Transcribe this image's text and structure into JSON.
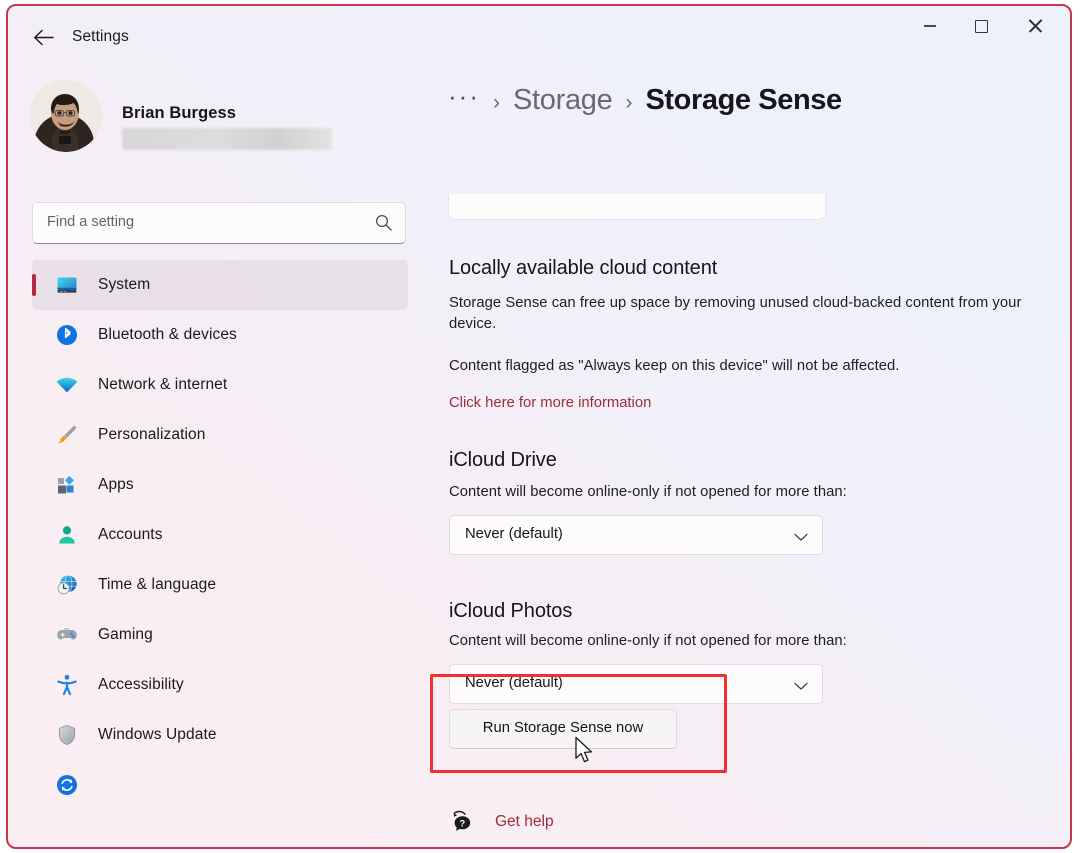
{
  "window": {
    "title": "Settings",
    "accent_border_color": "#c3394b",
    "controls": {
      "back": "back-arrow",
      "minimize": "minimize",
      "maximize": "maximize",
      "close": "close"
    }
  },
  "profile": {
    "name": "Brian Burgess",
    "email_redacted": true
  },
  "search": {
    "placeholder": "Find a setting",
    "value": ""
  },
  "sidebar": {
    "items": [
      {
        "label": "System",
        "icon": "monitor-icon",
        "selected": true
      },
      {
        "label": "Bluetooth & devices",
        "icon": "bluetooth-icon",
        "selected": false
      },
      {
        "label": "Network & internet",
        "icon": "wifi-icon",
        "selected": false
      },
      {
        "label": "Personalization",
        "icon": "paintbrush-icon",
        "selected": false
      },
      {
        "label": "Apps",
        "icon": "apps-icon",
        "selected": false
      },
      {
        "label": "Accounts",
        "icon": "person-icon",
        "selected": false
      },
      {
        "label": "Time & language",
        "icon": "clock-globe-icon",
        "selected": false
      },
      {
        "label": "Gaming",
        "icon": "gamepad-icon",
        "selected": false
      },
      {
        "label": "Accessibility",
        "icon": "accessibility-icon",
        "selected": false
      },
      {
        "label": "Windows Update",
        "icon": "refresh-icon",
        "selected": false
      }
    ]
  },
  "breadcrumb": {
    "overflow": "···",
    "separator": "›",
    "parent": "Storage",
    "current": "Storage Sense"
  },
  "main": {
    "cloud_section": {
      "title": "Locally available cloud content",
      "paragraph1": "Storage Sense can free up space by removing unused cloud-backed content from your device.",
      "paragraph2": "Content flagged as \"Always keep on this device\" will not be affected.",
      "link": "Click here for more information"
    },
    "icloud_drive": {
      "title": "iCloud Drive",
      "subtitle": "Content will become online-only if not opened for more than:",
      "dropdown_value": "Never (default)"
    },
    "icloud_photos": {
      "title": "iCloud Photos",
      "subtitle": "Content will become online-only if not opened for more than:",
      "dropdown_value": "Never (default)"
    },
    "run_button": {
      "label": "Run Storage Sense now",
      "highlighted": true,
      "highlight_color": "#f03030"
    },
    "get_help": {
      "label": "Get help",
      "color": "#9e2b3b"
    }
  }
}
